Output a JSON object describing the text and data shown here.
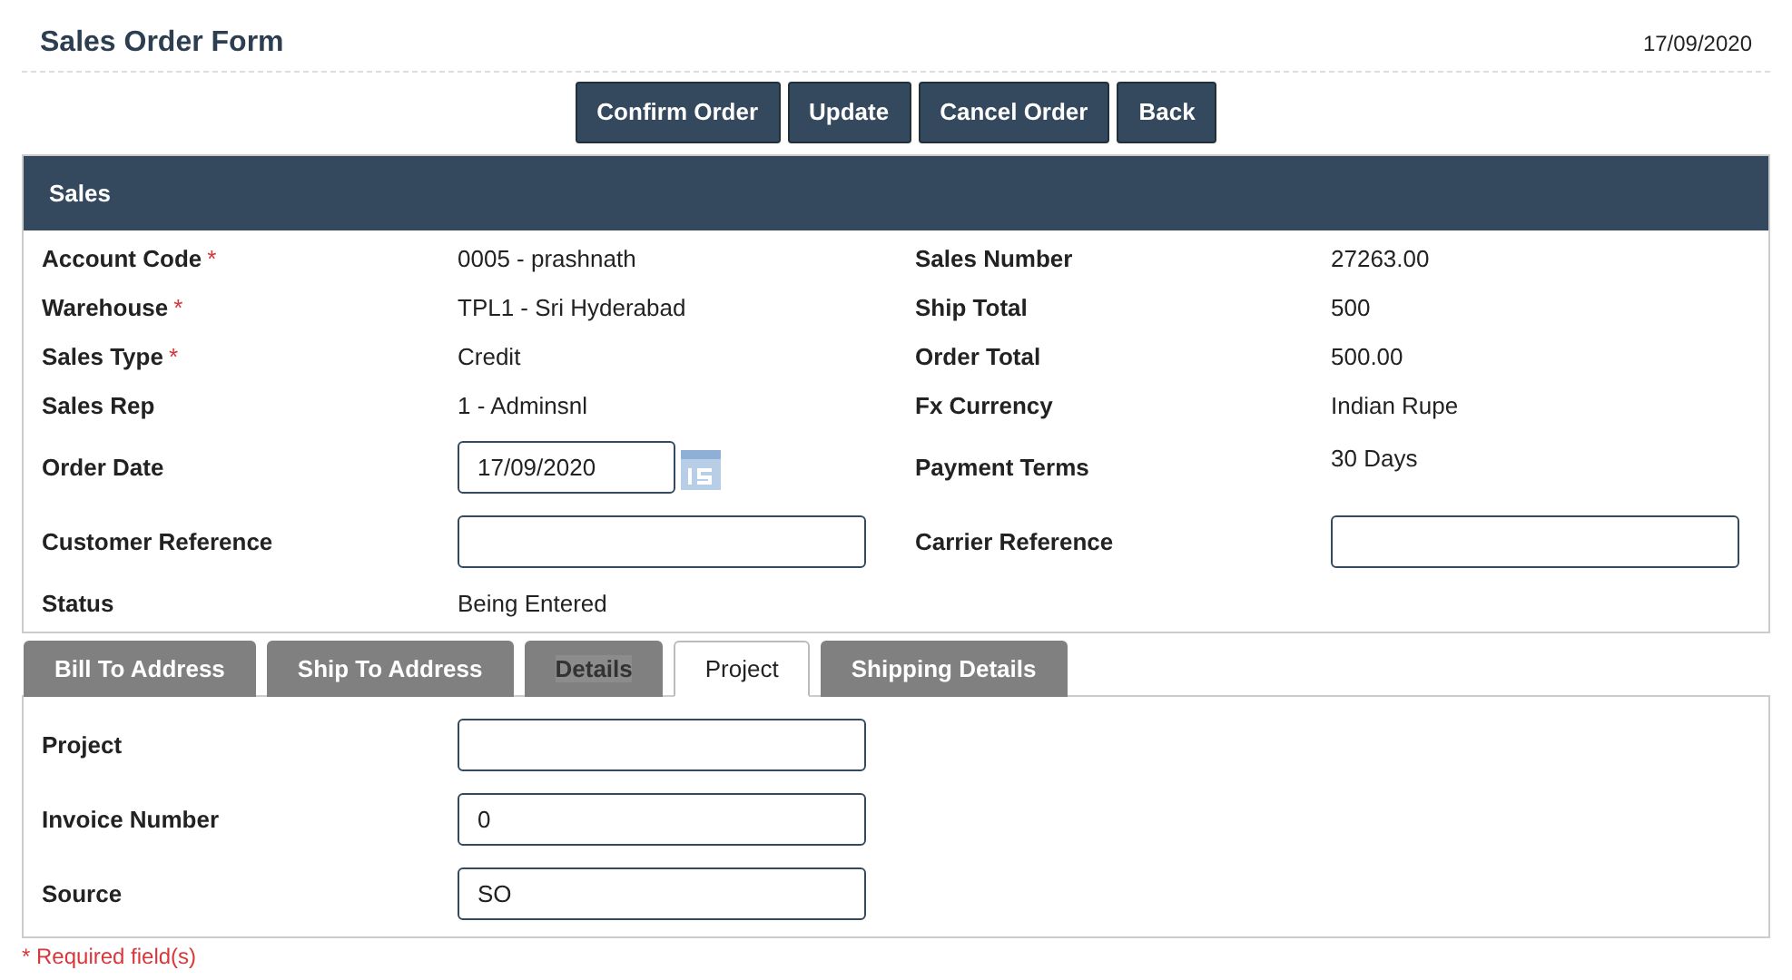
{
  "header": {
    "title": "Sales Order Form",
    "date": "17/09/2020"
  },
  "buttons": [
    "Confirm Order",
    "Update",
    "Cancel Order",
    "Back"
  ],
  "sales": {
    "title": "Sales",
    "rows": [
      {
        "left": {
          "label": "Account Code",
          "required_mark": "*",
          "kind": "text",
          "value": "0005 - prashnath"
        },
        "right": {
          "label": "Sales Number",
          "kind": "text",
          "value": "27263.00"
        }
      },
      {
        "left": {
          "label": "Warehouse",
          "required_mark": "*",
          "kind": "text",
          "value": "TPL1 - Sri Hyderabad"
        },
        "right": {
          "label": "Ship Total",
          "kind": "text",
          "value": "500"
        }
      },
      {
        "left": {
          "label": "Sales Type",
          "required_mark": "*",
          "kind": "text",
          "value": "Credit"
        },
        "right": {
          "label": "Order Total",
          "kind": "text",
          "value": "500.00"
        }
      },
      {
        "left": {
          "label": "Sales Rep",
          "kind": "text",
          "value": "1 - Adminsnl"
        },
        "right": {
          "label": "Fx Currency",
          "kind": "text",
          "value": "Indian Rupe"
        }
      },
      {
        "left": {
          "label": "Order Date",
          "kind": "date",
          "value": "17/09/2020"
        },
        "right": {
          "label": "Payment Terms",
          "kind": "text",
          "value": "30 Days"
        }
      },
      {
        "left": {
          "label": "Customer Reference",
          "kind": "input"
        },
        "right": {
          "label": "Carrier Reference",
          "kind": "input"
        }
      },
      {
        "left": {
          "label": "Status",
          "kind": "text",
          "value": "Being Entered"
        }
      }
    ]
  },
  "tabs": [
    {
      "label": "Bill To Address",
      "selected": false,
      "hovered": false
    },
    {
      "label": "Ship To Address",
      "selected": false,
      "hovered": false
    },
    {
      "label": "Details",
      "selected": false,
      "hovered": true
    },
    {
      "label": "Project",
      "selected": true,
      "hovered": false
    },
    {
      "label": "Shipping Details",
      "selected": false,
      "hovered": false
    }
  ],
  "project_fields": [
    {
      "label": "Project"
    },
    {
      "label": "Invoice Number",
      "value": "0"
    },
    {
      "label": "Source",
      "value": "SO"
    }
  ],
  "required_note": "* Required field(s)"
}
